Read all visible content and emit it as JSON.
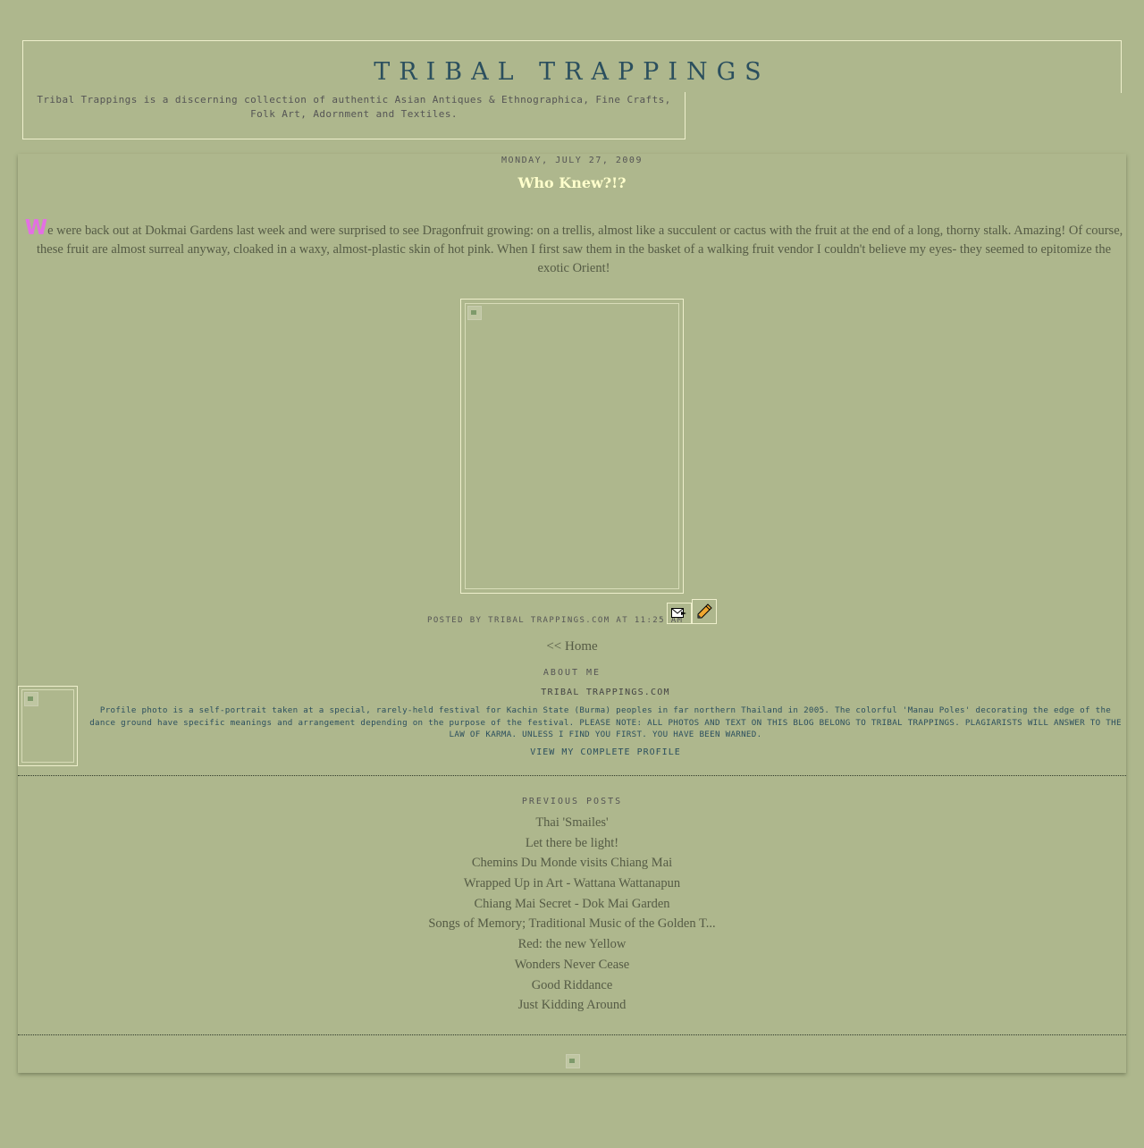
{
  "header": {
    "title": "TRIBAL TRAPPINGS",
    "description": "Tribal Trappings is a discerning collection of authentic Asian Antiques & Ethnographica, Fine Crafts, Folk Art, Adornment and Textiles."
  },
  "post": {
    "date": "MONDAY, JULY 27, 2009",
    "title": "Who Knew?!?",
    "drop_cap": "W",
    "body": "e were back out at Dokmai Gardens last week and were surprised to see Dragonfruit growing: on a trellis, almost like a succulent or cactus with the fruit at the end of a long, thorny stalk. Amazing! Of course, these fruit are almost surreal anyway, cloaked in a waxy, almost-plastic skin of hot pink. When I first saw them in the basket of a walking fruit vendor I couldn't believe my eyes- they seemed to epitomize the exotic Orient!",
    "footer": "POSTED BY TRIBAL TRAPPINGS.COM AT 11:25 AM",
    "email_icon": "email-post-icon",
    "edit_icon": "edit-pencil-icon"
  },
  "nav": {
    "home_label": "<< Home"
  },
  "about": {
    "heading": "ABOUT ME",
    "name": "TRIBAL TRAPPINGS.COM",
    "text": "Profile photo is a self-portrait taken at a special, rarely-held festival for Kachin State (Burma) peoples in far northern Thailand in 2005. The colorful 'Manau Poles' decorating the edge of the dance ground have specific meanings and arrangement depending on the purpose of the festival. PLEASE NOTE: ALL PHOTOS AND TEXT ON THIS BLOG BELONG TO TRIBAL TRAPPINGS. PLAGIARISTS WILL ANSWER TO THE LAW OF KARMA. UNLESS I FIND YOU FIRST. YOU HAVE BEEN WARNED.",
    "profile_link": "VIEW MY COMPLETE PROFILE"
  },
  "previous_posts": {
    "heading": "PREVIOUS POSTS",
    "items": [
      "Thai 'Smailes'",
      "Let there be light!",
      "Chemins Du Monde visits Chiang Mai",
      "Wrapped Up in Art - Wattana Wattanapun",
      "Chiang Mai Secret - Dok Mai Garden",
      "Songs of Memory; Traditional Music of the Golden T...",
      "Red: the new Yellow",
      "Wonders Never Cease",
      "Good Riddance",
      "Just Kidding Around"
    ]
  },
  "colors": {
    "background": "#aeb78d",
    "title": "#2b4f5e",
    "post_title": "#ffffcc",
    "drop_cap": "#e36fe3",
    "border": "#eeefcc"
  }
}
